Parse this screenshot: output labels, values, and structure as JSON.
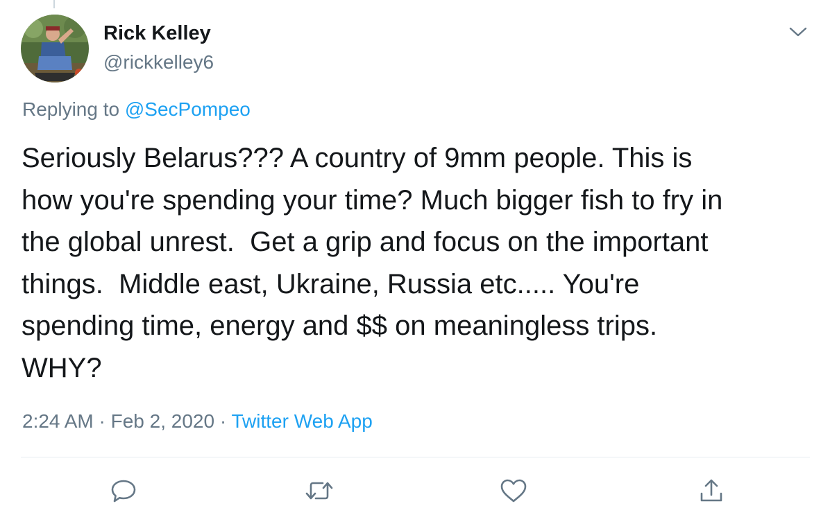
{
  "author": {
    "name": "Rick Kelley",
    "handle": "@rickkelley6"
  },
  "reply": {
    "prefix": "Replying to ",
    "mention": "@SecPompeo"
  },
  "body_lines": [
    "Seriously Belarus??? A country of 9mm people. This is",
    "how you're spending your time? Much bigger fish to fry in",
    "the global unrest.  Get a grip and focus on the important",
    "things.  Middle east, Ukraine, Russia etc..... You're",
    "spending time, energy and $$ on meaningless trips.",
    "WHY?"
  ],
  "meta": {
    "time": "2:24 AM",
    "separator": " · ",
    "date": "Feb 2, 2020",
    "source": "Twitter Web App"
  },
  "icons": {
    "more": "chevron-down-icon",
    "reply": "reply-bubble-icon",
    "retweet": "retweet-icon",
    "like": "heart-icon",
    "share": "share-icon"
  },
  "colors": {
    "text": "#14171a",
    "secondary": "#657786",
    "link": "#1da1f2",
    "divider": "#e6ecf0"
  }
}
